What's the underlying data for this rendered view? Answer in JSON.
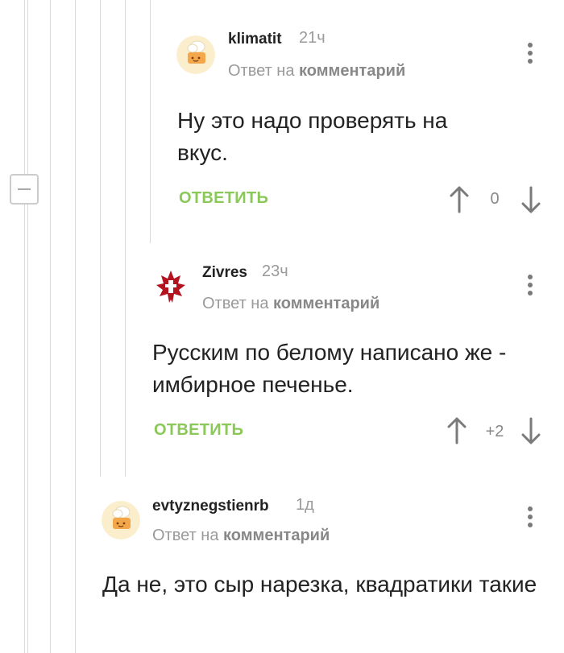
{
  "comments": [
    {
      "username": "klimatit",
      "time": "21ч",
      "reply_prefix": "Ответ на",
      "reply_target": "комментарий",
      "text": "Ну это надо проверять на вкус.",
      "reply_label": "ОТВЕТИТЬ",
      "rating": "0",
      "avatar": "cookie-chef-avatar"
    },
    {
      "username": "Zivres",
      "time": "23ч",
      "reply_prefix": "Ответ на",
      "reply_target": "комментарий",
      "text": "Русским по белому написано же - имбирное печенье.",
      "reply_label": "ОТВЕТИТЬ",
      "rating": "+2",
      "avatar": "horde-emblem-avatar"
    },
    {
      "username": "evtyznegstienrb",
      "time": "1д",
      "reply_prefix": "Ответ на",
      "reply_target": "комментарий",
      "text": "Да не, это сыр нарезка, квадратики такие",
      "avatar": "cookie-chef-avatar"
    }
  ],
  "colors": {
    "reply_green": "#8ac858",
    "meta_gray": "#9a9a9a",
    "thread_line": "#d9d9d9"
  },
  "icons": [
    "minus-icon",
    "more-icon",
    "arrow-up-icon",
    "arrow-down-icon"
  ]
}
